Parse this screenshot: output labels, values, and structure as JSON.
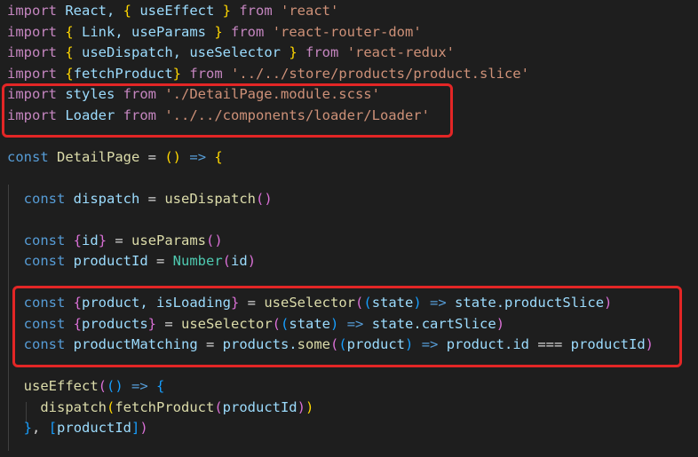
{
  "editor": {
    "language": "javascript",
    "highlight_color": "#e32626",
    "lines": [
      {
        "tokens": [
          [
            "import",
            "tok-kw"
          ],
          [
            " React, ",
            "tok-var"
          ],
          [
            "{",
            "tok-b1"
          ],
          [
            " useEffect ",
            "tok-var"
          ],
          [
            "}",
            "tok-b1"
          ],
          [
            " ",
            "tok-punc"
          ],
          [
            "from",
            "tok-kw"
          ],
          [
            " ",
            "tok-punc"
          ],
          [
            "'react'",
            "tok-str"
          ]
        ]
      },
      {
        "tokens": [
          [
            "import",
            "tok-kw"
          ],
          [
            " ",
            "tok-punc"
          ],
          [
            "{",
            "tok-b1"
          ],
          [
            " Link, useParams ",
            "tok-var"
          ],
          [
            "}",
            "tok-b1"
          ],
          [
            " ",
            "tok-punc"
          ],
          [
            "from",
            "tok-kw"
          ],
          [
            " ",
            "tok-punc"
          ],
          [
            "'react-router-dom'",
            "tok-str"
          ]
        ]
      },
      {
        "tokens": [
          [
            "import",
            "tok-kw"
          ],
          [
            " ",
            "tok-punc"
          ],
          [
            "{",
            "tok-b1"
          ],
          [
            " useDispatch, useSelector ",
            "tok-var"
          ],
          [
            "}",
            "tok-b1"
          ],
          [
            " ",
            "tok-punc"
          ],
          [
            "from",
            "tok-kw"
          ],
          [
            " ",
            "tok-punc"
          ],
          [
            "'react-redux'",
            "tok-str"
          ]
        ]
      },
      {
        "tokens": [
          [
            "import",
            "tok-kw"
          ],
          [
            " ",
            "tok-punc"
          ],
          [
            "{",
            "tok-b1"
          ],
          [
            "fetchProduct",
            "tok-var"
          ],
          [
            "}",
            "tok-b1"
          ],
          [
            " ",
            "tok-punc"
          ],
          [
            "from",
            "tok-kw"
          ],
          [
            " ",
            "tok-punc"
          ],
          [
            "'../../store/products/product.slice'",
            "tok-str"
          ]
        ]
      },
      {
        "tokens": [
          [
            "import",
            "tok-kw"
          ],
          [
            " styles ",
            "tok-var"
          ],
          [
            "from",
            "tok-kw"
          ],
          [
            " ",
            "tok-punc"
          ],
          [
            "'./DetailPage.module.scss'",
            "tok-str"
          ]
        ]
      },
      {
        "tokens": [
          [
            "import",
            "tok-kw"
          ],
          [
            " Loader ",
            "tok-var"
          ],
          [
            "from",
            "tok-kw"
          ],
          [
            " ",
            "tok-punc"
          ],
          [
            "'../../components/loader/Loader'",
            "tok-str"
          ]
        ]
      },
      {
        "tokens": []
      },
      {
        "tokens": [
          [
            "const",
            "tok-kw2"
          ],
          [
            " ",
            "tok-punc"
          ],
          [
            "DetailPage",
            "tok-fn"
          ],
          [
            " = ",
            "tok-punc"
          ],
          [
            "()",
            "tok-b1"
          ],
          [
            " ",
            "tok-punc"
          ],
          [
            "=>",
            "tok-kw2"
          ],
          [
            " ",
            "tok-punc"
          ],
          [
            "{",
            "tok-b1"
          ]
        ]
      },
      {
        "tokens": []
      },
      {
        "tokens": [
          [
            "  const",
            "tok-kw2"
          ],
          [
            " ",
            "tok-punc"
          ],
          [
            "dispatch",
            "tok-var"
          ],
          [
            " = ",
            "tok-punc"
          ],
          [
            "useDispatch",
            "tok-fn"
          ],
          [
            "()",
            "tok-b2"
          ]
        ]
      },
      {
        "tokens": []
      },
      {
        "tokens": [
          [
            "  const",
            "tok-kw2"
          ],
          [
            " ",
            "tok-punc"
          ],
          [
            "{",
            "tok-b2"
          ],
          [
            "id",
            "tok-var"
          ],
          [
            "}",
            "tok-b2"
          ],
          [
            " = ",
            "tok-punc"
          ],
          [
            "useParams",
            "tok-fn"
          ],
          [
            "()",
            "tok-b2"
          ]
        ]
      },
      {
        "tokens": [
          [
            "  const",
            "tok-kw2"
          ],
          [
            " ",
            "tok-punc"
          ],
          [
            "productId",
            "tok-var"
          ],
          [
            " = ",
            "tok-punc"
          ],
          [
            "Number",
            "tok-type"
          ],
          [
            "(",
            "tok-b2"
          ],
          [
            "id",
            "tok-var"
          ],
          [
            ")",
            "tok-b2"
          ]
        ]
      },
      {
        "tokens": []
      },
      {
        "tokens": [
          [
            "  const",
            "tok-kw2"
          ],
          [
            " ",
            "tok-punc"
          ],
          [
            "{",
            "tok-b2"
          ],
          [
            "product, isLoading",
            "tok-var"
          ],
          [
            "}",
            "tok-b2"
          ],
          [
            " = ",
            "tok-punc"
          ],
          [
            "useSelector",
            "tok-fn"
          ],
          [
            "(",
            "tok-b2"
          ],
          [
            "(",
            "tok-b3"
          ],
          [
            "state",
            "tok-var"
          ],
          [
            ")",
            "tok-b3"
          ],
          [
            " ",
            "tok-punc"
          ],
          [
            "=>",
            "tok-kw2"
          ],
          [
            " state.",
            "tok-var"
          ],
          [
            "productSlice",
            "tok-var"
          ],
          [
            ")",
            "tok-b2"
          ]
        ]
      },
      {
        "tokens": [
          [
            "  const",
            "tok-kw2"
          ],
          [
            " ",
            "tok-punc"
          ],
          [
            "{",
            "tok-b2"
          ],
          [
            "products",
            "tok-var"
          ],
          [
            "}",
            "tok-b2"
          ],
          [
            " = ",
            "tok-punc"
          ],
          [
            "useSelector",
            "tok-fn"
          ],
          [
            "(",
            "tok-b2"
          ],
          [
            "(",
            "tok-b3"
          ],
          [
            "state",
            "tok-var"
          ],
          [
            ")",
            "tok-b3"
          ],
          [
            " ",
            "tok-punc"
          ],
          [
            "=>",
            "tok-kw2"
          ],
          [
            " state.",
            "tok-var"
          ],
          [
            "cartSlice",
            "tok-var"
          ],
          [
            ")",
            "tok-b2"
          ]
        ]
      },
      {
        "tokens": [
          [
            "  const",
            "tok-kw2"
          ],
          [
            " ",
            "tok-punc"
          ],
          [
            "productMatching",
            "tok-var"
          ],
          [
            " = ",
            "tok-punc"
          ],
          [
            "products.",
            "tok-var"
          ],
          [
            "some",
            "tok-fn"
          ],
          [
            "(",
            "tok-b2"
          ],
          [
            "(",
            "tok-b3"
          ],
          [
            "product",
            "tok-var"
          ],
          [
            ")",
            "tok-b3"
          ],
          [
            " ",
            "tok-punc"
          ],
          [
            "=>",
            "tok-kw2"
          ],
          [
            " product.id ",
            "tok-var"
          ],
          [
            "===",
            "tok-punc"
          ],
          [
            " productId",
            "tok-var"
          ],
          [
            ")",
            "tok-b2"
          ]
        ]
      },
      {
        "tokens": []
      },
      {
        "tokens": [
          [
            "  ",
            "tok-punc"
          ],
          [
            "useEffect",
            "tok-fn"
          ],
          [
            "(",
            "tok-b2"
          ],
          [
            "()",
            "tok-b3"
          ],
          [
            " ",
            "tok-punc"
          ],
          [
            "=>",
            "tok-kw2"
          ],
          [
            " ",
            "tok-punc"
          ],
          [
            "{",
            "tok-b3"
          ]
        ]
      },
      {
        "tokens": [
          [
            "    ",
            "tok-punc"
          ],
          [
            "dispatch",
            "tok-fn"
          ],
          [
            "(",
            "tok-b1"
          ],
          [
            "fetchProduct",
            "tok-fn"
          ],
          [
            "(",
            "tok-b2"
          ],
          [
            "productId",
            "tok-var"
          ],
          [
            ")",
            "tok-b2"
          ],
          [
            ")",
            "tok-b1"
          ]
        ]
      },
      {
        "tokens": [
          [
            "  ",
            "tok-punc"
          ],
          [
            "}",
            "tok-b3"
          ],
          [
            ", ",
            "tok-punc"
          ],
          [
            "[",
            "tok-b3"
          ],
          [
            "productId",
            "tok-var"
          ],
          [
            "]",
            "tok-b3"
          ],
          [
            ")",
            "tok-b2"
          ]
        ]
      }
    ]
  }
}
